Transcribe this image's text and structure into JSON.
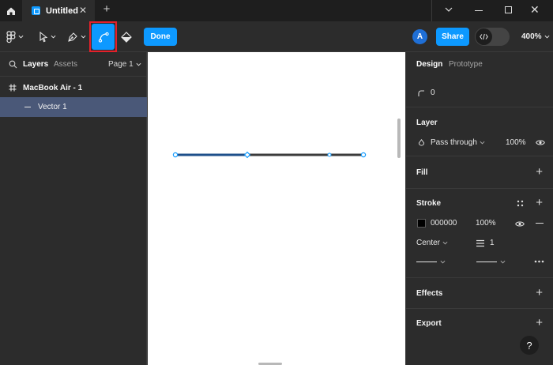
{
  "titlebar": {
    "tab_title": "Untitled",
    "icons": [
      "home-icon",
      "file-icon",
      "close-icon",
      "plus-icon",
      "chevron-down-icon",
      "minimize-icon",
      "maximize-icon",
      "close-icon"
    ]
  },
  "toolbar": {
    "done_label": "Done",
    "avatar_initial": "A",
    "share_label": "Share",
    "zoom_level": "400%",
    "active_tool": "bend-tool",
    "accent_color": "#0d99ff",
    "highlight_color": "#e5202a"
  },
  "left_panel": {
    "tab_layers": "Layers",
    "tab_assets": "Assets",
    "page_selector": "Page 1",
    "layers": [
      {
        "label": "MacBook Air - 1",
        "type": "frame"
      },
      {
        "label": "Vector 1",
        "type": "vector",
        "selected": true
      }
    ],
    "selection_color": "#4a5878"
  },
  "right_panel": {
    "tab_design": "Design",
    "tab_prototype": "Prototype",
    "corner_radius": "0",
    "layer": {
      "title": "Layer",
      "blend_mode": "Pass through",
      "opacity": "100%"
    },
    "fill": {
      "title": "Fill"
    },
    "stroke": {
      "title": "Stroke",
      "color_hex": "000000",
      "opacity": "100%",
      "position": "Center",
      "weight": "1"
    },
    "effects": {
      "title": "Effects"
    },
    "export": {
      "title": "Export"
    }
  },
  "help": {
    "label": "?"
  }
}
